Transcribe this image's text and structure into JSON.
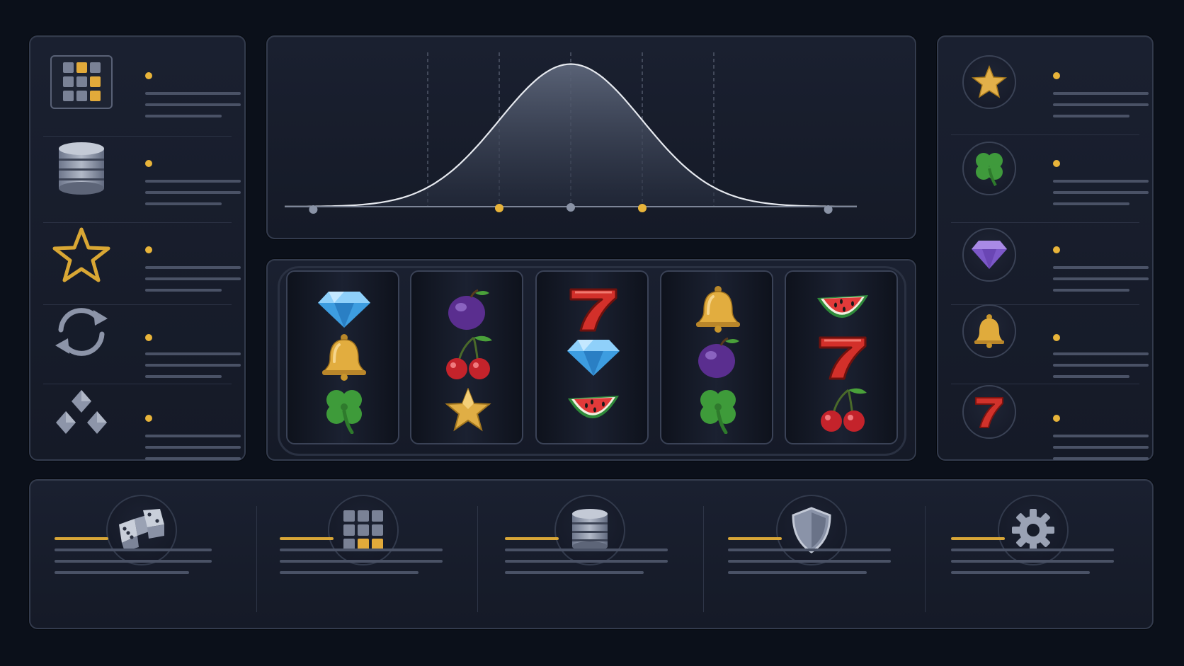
{
  "left_panel": {
    "items": [
      {
        "icon": "grid-icon"
      },
      {
        "icon": "database-icon"
      },
      {
        "icon": "star-outline-icon"
      },
      {
        "icon": "refresh-icon"
      },
      {
        "icon": "diamonds-icon"
      }
    ]
  },
  "right_panel": {
    "items": [
      {
        "icon": "star-icon"
      },
      {
        "icon": "clover-icon"
      },
      {
        "icon": "gem-icon"
      },
      {
        "icon": "bell-icon"
      },
      {
        "icon": "seven-icon"
      }
    ]
  },
  "chart_data": {
    "type": "line",
    "title": "",
    "xlabel": "",
    "ylabel": "",
    "series": [
      {
        "x": [
          -4,
          -3.5,
          -3,
          -2.5,
          -2,
          -1.5,
          -1,
          -0.5,
          0,
          0.5,
          1,
          1.5,
          2,
          2.5,
          3,
          3.5,
          4
        ],
        "values": [
          0.0001,
          0.0009,
          0.0044,
          0.0175,
          0.054,
          0.1295,
          0.242,
          0.3521,
          0.3989,
          0.3521,
          0.242,
          0.1295,
          0.054,
          0.0175,
          0.0044,
          0.0009,
          0.0001
        ]
      }
    ],
    "guides_x": [
      -2,
      -1,
      0,
      1,
      2
    ],
    "markers": [
      {
        "x": -3.6,
        "color": "#8a93a6"
      },
      {
        "x": -1,
        "color": "#e8b43a"
      },
      {
        "x": 0,
        "color": "#8a93a6"
      },
      {
        "x": 1,
        "color": "#e8b43a"
      },
      {
        "x": 3.6,
        "color": "#8a93a6"
      }
    ],
    "xlim": [
      -4,
      4
    ],
    "ylim": [
      0,
      0.4
    ],
    "grid": false,
    "colors": {
      "curve": "#e6e9ef",
      "fill": "#5a6275",
      "guide": "#6b7386",
      "axis": "#7c8597"
    }
  },
  "reels": [
    [
      "gem-blue-icon",
      "bell-icon",
      "clover-icon"
    ],
    [
      "plum-icon",
      "cherries-icon",
      "star-icon"
    ],
    [
      "seven-icon",
      "gem-blue-icon",
      "watermelon-icon"
    ],
    [
      "bell-icon",
      "plum-icon",
      "clover-icon"
    ],
    [
      "watermelon-icon",
      "seven-icon",
      "cherries-icon"
    ]
  ],
  "bottom_cards": [
    {
      "icon": "dice-icon"
    },
    {
      "icon": "grid-icon"
    },
    {
      "icon": "database-icon"
    },
    {
      "icon": "shield-icon"
    },
    {
      "icon": "gear-icon"
    }
  ],
  "colors": {
    "accent": "#e8b43a",
    "background": "#0b101a",
    "panel": "#181d2b",
    "border": "#333b4d",
    "placeholder_line": "#4a5266"
  }
}
